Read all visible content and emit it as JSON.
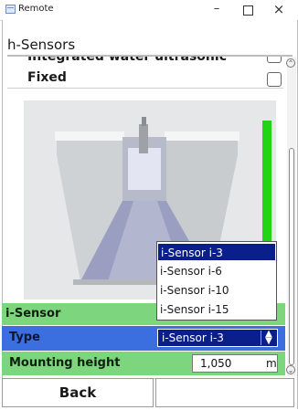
{
  "window": {
    "title": "Remote",
    "minimize_glyph": "–",
    "close_glyph": "×"
  },
  "section": {
    "title": "h-Sensors"
  },
  "list": {
    "partial_item": "Integrated water ultrasonic",
    "fixed_label": "Fixed"
  },
  "graphic": {
    "level_bar_color": "#22d414"
  },
  "form": {
    "isensor_label": "i-Sensor",
    "type_label": "Type",
    "type_value": "i-Sensor i-3",
    "mount_label": "Mounting height",
    "mount_value": "1,050",
    "mount_unit": "m"
  },
  "dropdown": {
    "options": [
      "i-Sensor i-3",
      "i-Sensor i-6",
      "i-Sensor i-10",
      "i-Sensor i-15"
    ],
    "selected_index": 0
  },
  "buttons": {
    "back_label": "Back"
  },
  "icons": {
    "app": "remote-app-icon",
    "scroll_up": "chevron-up-icon",
    "scroll_down": "chevron-down-icon",
    "select_arrow": "updown-arrow-icon"
  },
  "colors": {
    "row_green": "#7dd67d",
    "row_selected_blue": "#3b6fe0",
    "select_navy": "#0a1f8c"
  }
}
